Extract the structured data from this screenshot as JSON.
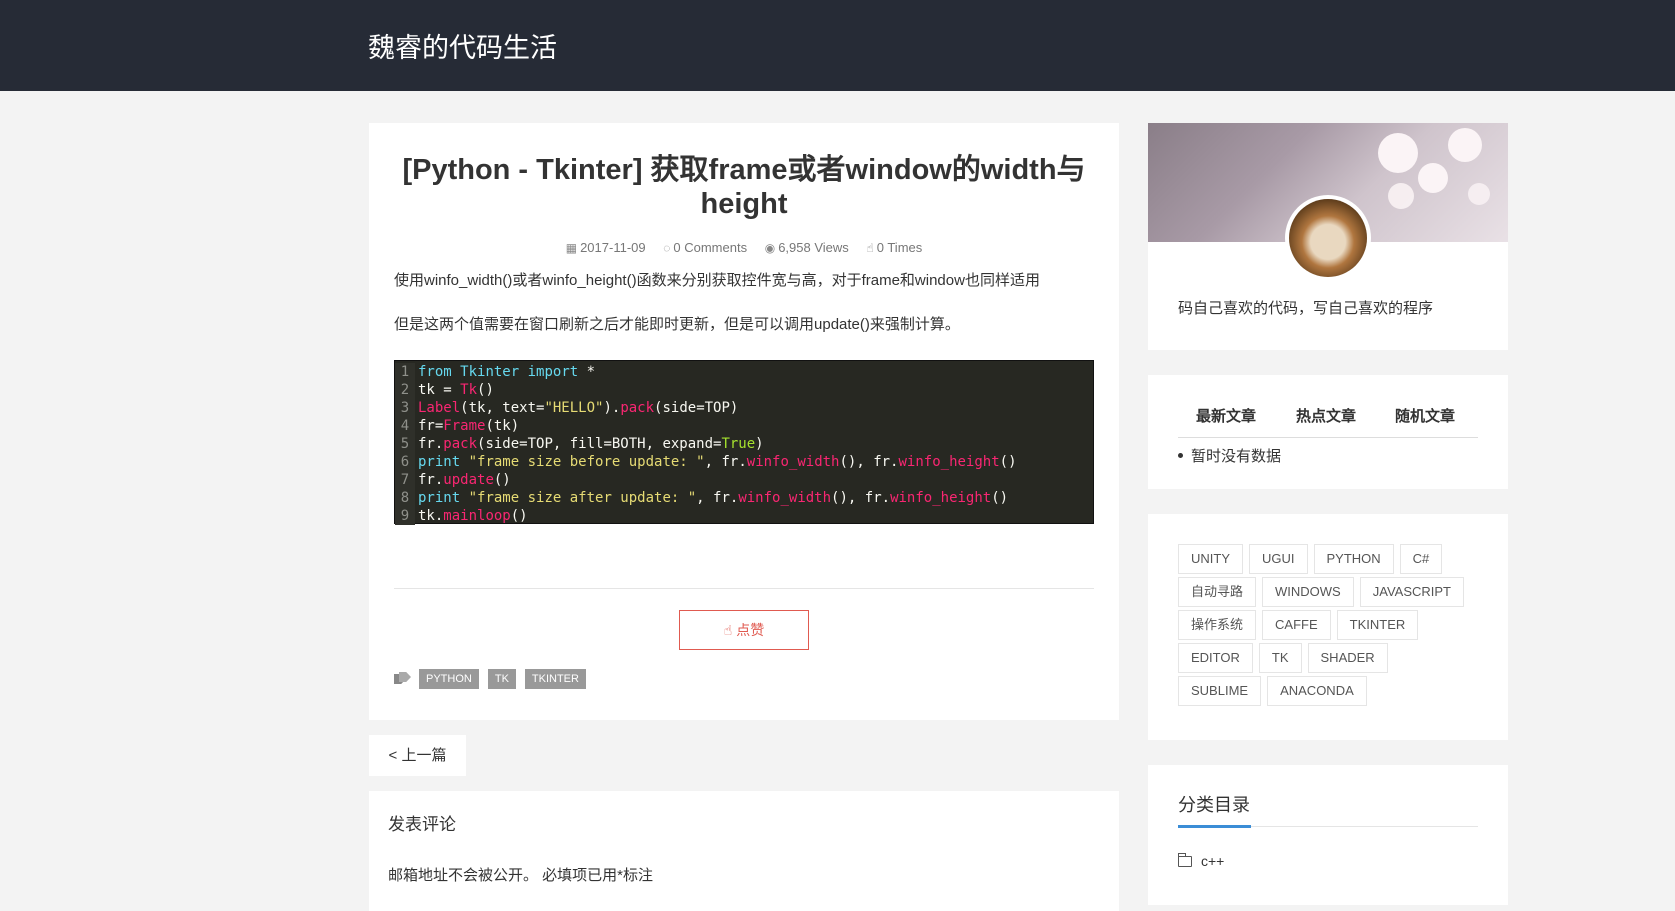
{
  "site": {
    "title": "魏睿的代码生活"
  },
  "post": {
    "title": "[Python - Tkinter] 获取frame或者window的width与height",
    "meta": {
      "date": "2017-11-09",
      "comments": "0 Comments",
      "views": "6,958 Views",
      "likes": "0 Times"
    },
    "paragraphs": [
      "使用winfo_width()或者winfo_height()函数来分别获取控件宽与高，对于frame和window也同样适用",
      "但是这两个值需要在窗口刷新之后才能即时更新，但是可以调用update()来强制计算。"
    ],
    "like_label": "点赞",
    "tags": [
      "PYTHON",
      "TK",
      "TKINTER"
    ]
  },
  "code": [
    "from Tkinter import *",
    "tk = Tk()",
    "Label(tk, text=\"HELLO\").pack(side=TOP)",
    "fr=Frame(tk)",
    "fr.pack(side=TOP, fill=BOTH, expand=True)",
    "print \"frame size before update: \", fr.winfo_width(), fr.winfo_height()",
    "fr.update()",
    "print \"frame size after update: \", fr.winfo_width(), fr.winfo_height()",
    "tk.mainloop()"
  ],
  "nav": {
    "prev_label": "< 上一篇"
  },
  "comment": {
    "title": "发表评论",
    "note": "邮箱地址不会被公开。 必填项已用*标注"
  },
  "sidebar": {
    "motto": "码自己喜欢的代码，写自己喜欢的程序",
    "tabs": [
      "最新文章",
      "热点文章",
      "随机文章"
    ],
    "empty": "暂时没有数据",
    "tag_rows": [
      [
        "UNITY",
        "UGUI",
        "PYTHON",
        "C#"
      ],
      [
        "自动寻路",
        "WINDOWS",
        "JAVASCRIPT"
      ],
      [
        "操作系统",
        "CAFFE",
        "TKINTER"
      ],
      [
        "EDITOR",
        "TK",
        "SHADER"
      ],
      [
        "SUBLIME",
        "ANACONDA"
      ]
    ],
    "categories_title": "分类目录",
    "categories": [
      "c++"
    ]
  },
  "colors": {
    "topbar": "#262b36",
    "accent_red": "#e05a50",
    "accent_blue": "#3b8dd6",
    "code_bg": "#272822"
  }
}
